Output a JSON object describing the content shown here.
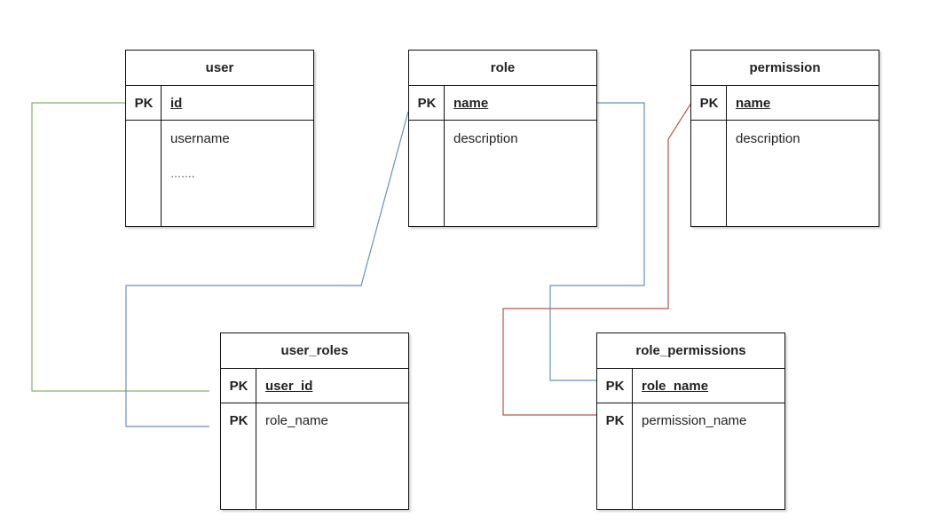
{
  "entities": {
    "user": {
      "name": "user",
      "pk_label": "PK",
      "pk_field": "id",
      "fields": [
        "username",
        "……."
      ]
    },
    "role": {
      "name": "role",
      "pk_label": "PK",
      "pk_field": "name",
      "fields": [
        "description"
      ]
    },
    "permission": {
      "name": "permission",
      "pk_label": "PK",
      "pk_field": "name",
      "fields": [
        "description"
      ]
    },
    "user_roles": {
      "name": "user_roles",
      "pk_label_1": "PK",
      "pk_field_1": "user_id",
      "pk_label_2": "PK",
      "pk_field_2": "role_name"
    },
    "role_permissions": {
      "name": "role_permissions",
      "pk_label_1": "PK",
      "pk_field_1": "role_name",
      "pk_label_2": "PK",
      "pk_field_2": "permission_name"
    }
  },
  "link_colors": {
    "user_to_user_roles": "#82b366",
    "role_to_user_roles": "#6c8ebf",
    "role_to_role_permissions": "#6c8ebf",
    "permission_to_role_permissions": "#b85450"
  }
}
